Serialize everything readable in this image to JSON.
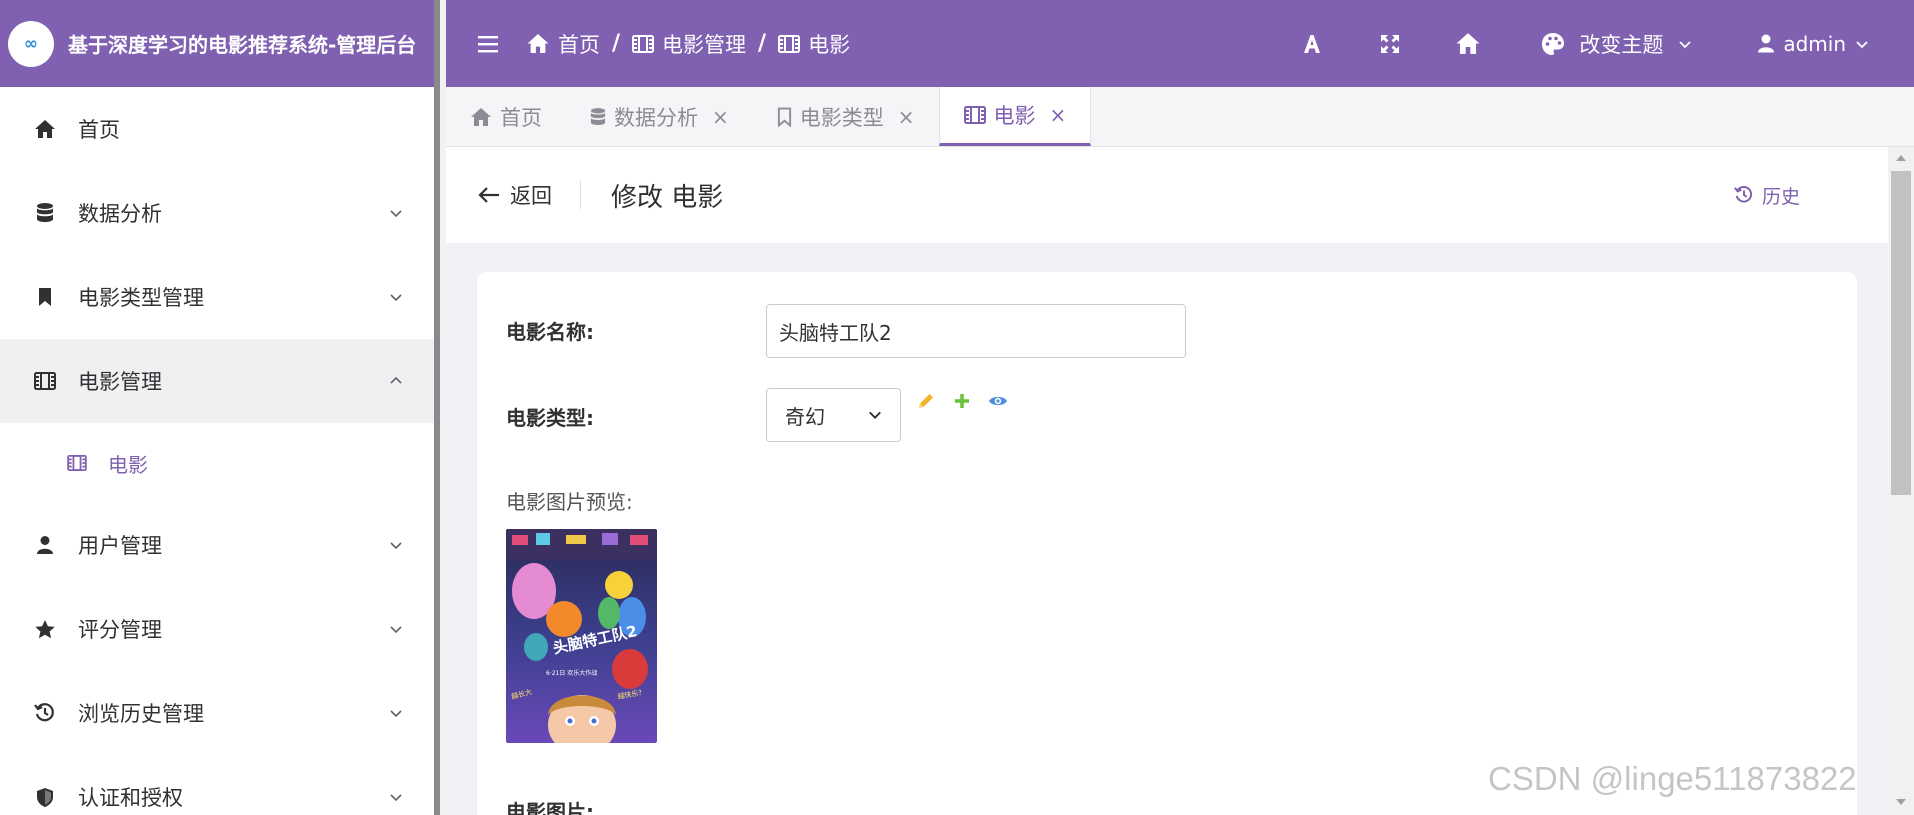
{
  "app": {
    "title": "基于深度学习的电影推荐系统-管理后台",
    "logo_text": "∞"
  },
  "sidebar": {
    "items": [
      {
        "label": "首页",
        "icon": "home-icon"
      },
      {
        "label": "数据分析",
        "icon": "database-icon"
      },
      {
        "label": "电影类型管理",
        "icon": "bookmark-icon"
      },
      {
        "label": "电影管理",
        "icon": "film-icon",
        "expanded": true
      },
      {
        "label": "用户管理",
        "icon": "user-icon"
      },
      {
        "label": "评分管理",
        "icon": "star-icon"
      },
      {
        "label": "浏览历史管理",
        "icon": "history-icon"
      },
      {
        "label": "认证和授权",
        "icon": "shield-icon"
      }
    ],
    "subitem": {
      "label": "电影",
      "icon": "film-icon"
    }
  },
  "header": {
    "breadcrumb": [
      "首页",
      "电影管理",
      "电影"
    ],
    "breadcrumb_sep": "/",
    "theme_label": "改变主题",
    "user_label": "admin",
    "color": "#8060b0"
  },
  "tabs": [
    {
      "label": "首页",
      "closable": false
    },
    {
      "label": "数据分析",
      "closable": true
    },
    {
      "label": "电影类型",
      "closable": true
    },
    {
      "label": "电影",
      "closable": true,
      "active": true
    }
  ],
  "tab_close": "×",
  "page": {
    "back_label": "返回",
    "title": "修改 电影",
    "history_label": "历史"
  },
  "form": {
    "name_label": "电影名称:",
    "name_value": "头脑特工队2",
    "type_label": "电影类型:",
    "type_value": "奇幻",
    "preview_label": "电影图片预览:",
    "image_label": "电影图片:"
  },
  "poster": {
    "title": "头脑特工队2",
    "date": "6·21日 欢乐大作战",
    "tag_left": "越长大",
    "tag_right": "越快乐？"
  },
  "watermark": "CSDN @linge511873822"
}
